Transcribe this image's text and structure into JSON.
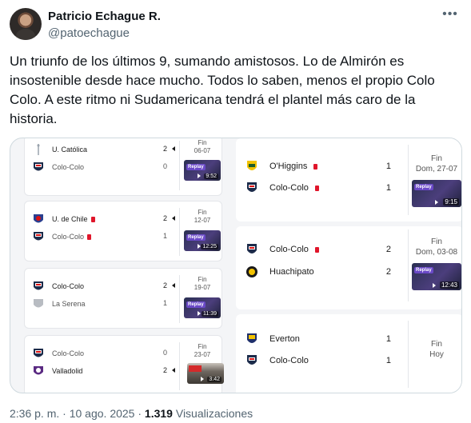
{
  "author": {
    "name": "Patricio Echague R.",
    "handle": "@patoechague"
  },
  "tweet_text": "Un triunfo de los últimos 9, sumando amistosos. Lo de Almirón es insostenible desde hace mucho. Todos lo saben, menos el propio Colo Colo. A este ritmo ni Sudamericana tendrá el plantel más caro de la historia.",
  "more_icon": "more-icon",
  "left_matches": [
    {
      "home": "U. Católica",
      "home_score": "2",
      "away": "Colo-Colo",
      "away_score": "0",
      "status": "Fin",
      "date": "06-07",
      "duration": "9:52",
      "replay": "Replay"
    },
    {
      "home": "U. de Chile",
      "home_score": "2",
      "away": "Colo-Colo",
      "away_score": "1",
      "status": "Fin",
      "date": "12-07",
      "duration": "12:25",
      "replay": "Replay"
    },
    {
      "home": "Colo-Colo",
      "home_score": "2",
      "away": "La Serena",
      "away_score": "1",
      "status": "Fin",
      "date": "19-07",
      "duration": "11:39",
      "replay": "Replay"
    },
    {
      "home": "Colo-Colo",
      "home_score": "0",
      "away": "Valladolid",
      "away_score": "2",
      "status": "Fin",
      "date": "23-07",
      "duration": "3:42"
    }
  ],
  "right_matches": [
    {
      "home": "O'Higgins",
      "home_score": "1",
      "away": "Colo-Colo",
      "away_score": "1",
      "status": "Fin",
      "date": "Dom, 27-07",
      "duration": "9:15",
      "replay": "Replay"
    },
    {
      "home": "Colo-Colo",
      "home_score": "2",
      "away": "Huachipato",
      "away_score": "2",
      "status": "Fin",
      "date": "Dom, 03-08",
      "duration": "12:43",
      "replay": "Replay"
    },
    {
      "home": "Everton",
      "home_score": "1",
      "away": "Colo-Colo",
      "away_score": "1",
      "status": "Fin",
      "date": "Hoy"
    }
  ],
  "footer": {
    "time": "2:36 p. m.",
    "sep": "·",
    "date": "10 ago. 2025",
    "views_count": "1.319",
    "views_label": "Visualizaciones"
  },
  "colors": {
    "red_card": "#e0162b",
    "replay_badge": "#6a49c7",
    "muted": "#536471"
  }
}
